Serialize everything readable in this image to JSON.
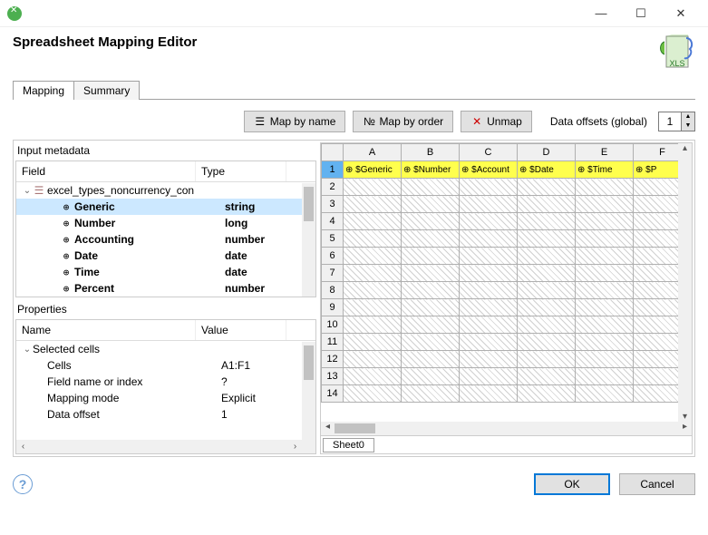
{
  "window": {
    "title": "Spreadsheet Mapping Editor",
    "titlebar_buttons": {
      "min": "—",
      "max": "☐",
      "close": "✕"
    }
  },
  "tabs": [
    "Mapping",
    "Summary"
  ],
  "active_tab": 0,
  "toolbar": {
    "map_by_name": "Map by name",
    "map_by_order": "Map by order",
    "unmap": "Unmap",
    "offsets_label": "Data offsets (global)",
    "offsets_value": "1"
  },
  "metadata": {
    "panel_title": "Input metadata",
    "cols": [
      "Field",
      "Type"
    ],
    "group": "excel_types_noncurrency_con",
    "fields": [
      {
        "name": "Generic",
        "type": "string",
        "selected": true
      },
      {
        "name": "Number",
        "type": "long",
        "selected": false
      },
      {
        "name": "Accounting",
        "type": "number",
        "selected": false
      },
      {
        "name": "Date",
        "type": "date",
        "selected": false
      },
      {
        "name": "Time",
        "type": "date",
        "selected": false
      },
      {
        "name": "Percent",
        "type": "number",
        "selected": false
      }
    ]
  },
  "properties": {
    "panel_title": "Properties",
    "cols": [
      "Name",
      "Value"
    ],
    "group": "Selected cells",
    "rows": [
      {
        "name": "Cells",
        "value": "A1:F1"
      },
      {
        "name": "Field name or index",
        "value": "?"
      },
      {
        "name": "Mapping mode",
        "value": "Explicit"
      },
      {
        "name": "Data offset",
        "value": "1"
      }
    ]
  },
  "sheet": {
    "columns": [
      "A",
      "B",
      "C",
      "D",
      "E",
      "F"
    ],
    "data_row": 1,
    "data_cells": [
      "$Generic",
      "$Number",
      "$Account",
      "$Date",
      "$Time",
      "$P"
    ],
    "blank_row_start": 2,
    "blank_row_end": 14,
    "active_sheet": "Sheet0"
  },
  "footer": {
    "ok": "OK",
    "cancel": "Cancel"
  }
}
